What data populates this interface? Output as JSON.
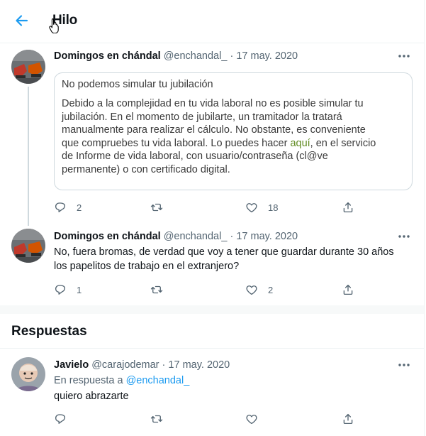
{
  "header": {
    "title": "Hilo"
  },
  "tweets": [
    {
      "name": "Domingos en chándal",
      "handle": "@enchandal_",
      "separator": "·",
      "date": "17 may. 2020",
      "card": {
        "title": "No podemos simular tu jubilación",
        "body_lines": [
          "Debido a la complejidad en tu vida laboral no es posible simular tu",
          "jubilación. En el momento de jubilarte, un tramitador la tratará",
          "manualmente para realizar el cálculo. No obstante, es conveniente",
          "que compruebes tu vida laboral. Lo puedes hacer ",
          "aquí",
          ", en el servicio",
          "de Informe de vida laboral, con usuario/contraseña (cl@ve",
          "permanente) o con certificado digital."
        ]
      },
      "replies": "2",
      "likes": "18"
    },
    {
      "name": "Domingos en chándal",
      "handle": "@enchandal_",
      "separator": "·",
      "date": "17 may. 2020",
      "text_lines": [
        "No, fuera bromas, de verdad que voy a tener que guardar durante 30 años",
        "los papelitos de trabajo en el extranjero?"
      ],
      "replies": "1",
      "likes": "2"
    }
  ],
  "replies_section": {
    "title": "Respuestas"
  },
  "reply": {
    "name": "Javielo",
    "handle": "@carajodemar",
    "separator": "·",
    "date": "17 may. 2020",
    "reply_prefix": "En respuesta a",
    "reply_mention": "@enchandal_",
    "text": "quiero abrazarte"
  },
  "colors": {
    "accent": "#1d9bf0",
    "secondary_text": "#536471",
    "link_green": "#5f8a1f"
  }
}
